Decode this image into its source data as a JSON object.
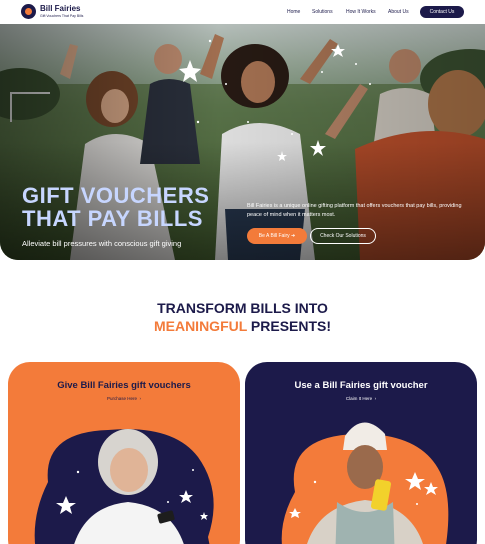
{
  "brand": {
    "name": "Bill Fairies",
    "tagline": "Gift Vouchers That Pay Bills"
  },
  "nav": {
    "links": [
      "Home",
      "Solutions",
      "How It Works",
      "About Us"
    ],
    "cta": "Contact Us"
  },
  "hero": {
    "title_line1": "GIFT VOUCHERS",
    "title_line2": "THAT PAY BILLS",
    "subtitle": "Alleviate bill pressures with conscious gift giving",
    "description": "Bill Fairies is a unique online gifting platform that offers vouchers that pay bills, providing peace of mind when it matters most.",
    "primary_button": "Be A Bill Fairy",
    "secondary_button": "Check Our Solutions"
  },
  "section": {
    "title_line1": "TRANSFORM BILLS INTO",
    "title_accent": "MEANINGFUL",
    "title_rest": " PRESENTS!"
  },
  "cards": [
    {
      "title": "Give Bill Fairies gift vouchers",
      "link": "Purchase Here"
    },
    {
      "title": "Use a Bill Fairies gift voucher",
      "link": "Claim It Here"
    }
  ],
  "colors": {
    "navy": "#1c1a4a",
    "orange": "#f37b3a",
    "hero_title": "#c7d6ff"
  }
}
